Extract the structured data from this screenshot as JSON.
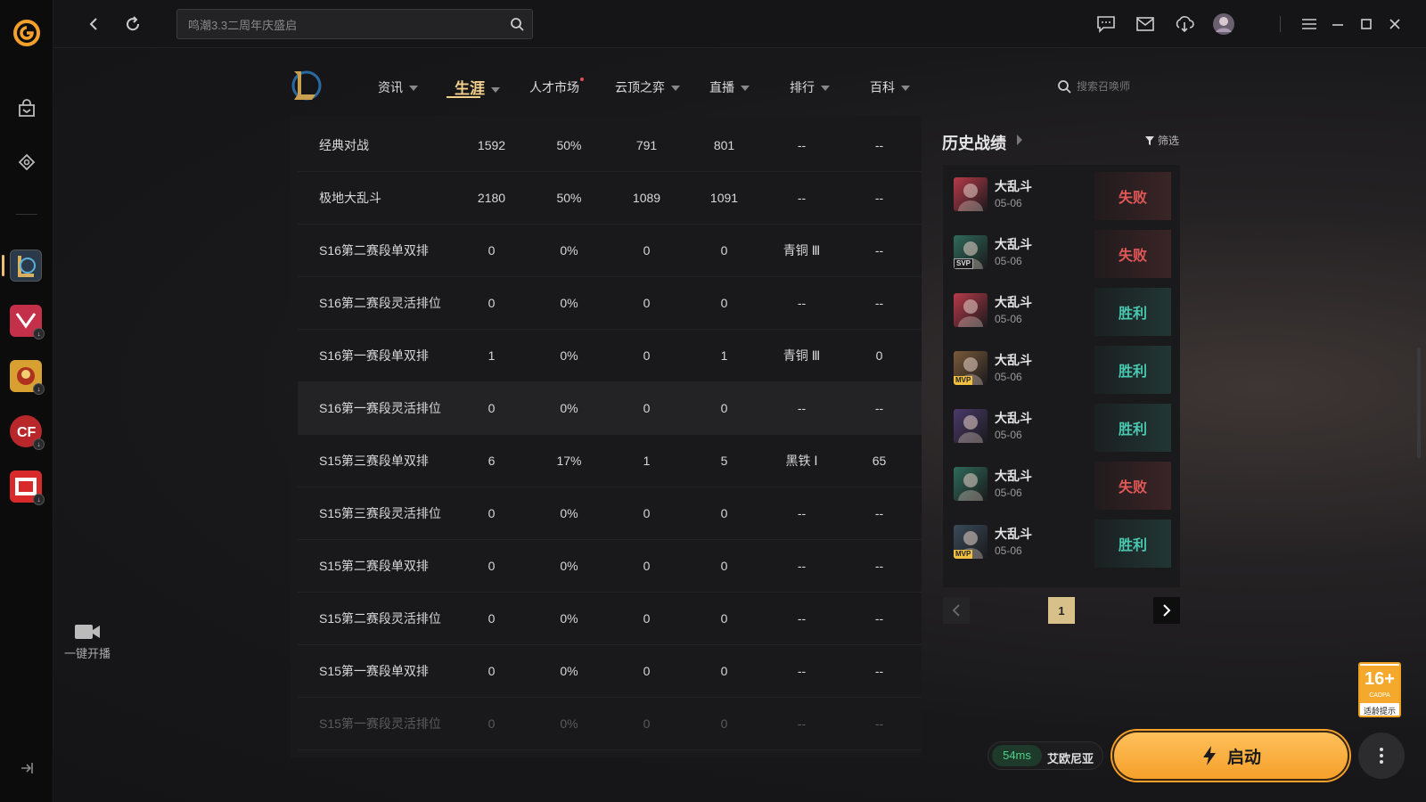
{
  "topbar": {
    "search_value": "鸣潮3.3二周年庆盛启"
  },
  "nav": {
    "items": [
      {
        "label": "资讯",
        "caret": true
      },
      {
        "label": "生涯",
        "caret": true,
        "active": true
      },
      {
        "label": "人才市场",
        "dot": true
      },
      {
        "label": "云顶之弈",
        "caret": true
      },
      {
        "label": "直播",
        "caret": true
      },
      {
        "label": "排行",
        "caret": true
      },
      {
        "label": "百科",
        "caret": true
      }
    ],
    "summoner_search_placeholder": "搜索召唤师"
  },
  "stats": {
    "rows": [
      {
        "mode": "经典对战",
        "games": "1592",
        "winrate": "50%",
        "wins": "791",
        "losses": "801",
        "rank": "--",
        "points": "--"
      },
      {
        "mode": "极地大乱斗",
        "games": "2180",
        "winrate": "50%",
        "wins": "1089",
        "losses": "1091",
        "rank": "--",
        "points": "--"
      },
      {
        "mode": "S16第二赛段单双排",
        "games": "0",
        "winrate": "0%",
        "wins": "0",
        "losses": "0",
        "rank": "青铜 Ⅲ",
        "points": "--"
      },
      {
        "mode": "S16第二赛段灵活排位",
        "games": "0",
        "winrate": "0%",
        "wins": "0",
        "losses": "0",
        "rank": "--",
        "points": "--"
      },
      {
        "mode": "S16第一赛段单双排",
        "games": "1",
        "winrate": "0%",
        "wins": "0",
        "losses": "1",
        "rank": "青铜 Ⅲ",
        "points": "0"
      },
      {
        "mode": "S16第一赛段灵活排位",
        "games": "0",
        "winrate": "0%",
        "wins": "0",
        "losses": "0",
        "rank": "--",
        "points": "--"
      },
      {
        "mode": "S15第三赛段单双排",
        "games": "6",
        "winrate": "17%",
        "wins": "1",
        "losses": "5",
        "rank": "黑铁 Ⅰ",
        "points": "65"
      },
      {
        "mode": "S15第三赛段灵活排位",
        "games": "0",
        "winrate": "0%",
        "wins": "0",
        "losses": "0",
        "rank": "--",
        "points": "--"
      },
      {
        "mode": "S15第二赛段单双排",
        "games": "0",
        "winrate": "0%",
        "wins": "0",
        "losses": "0",
        "rank": "--",
        "points": "--"
      },
      {
        "mode": "S15第二赛段灵活排位",
        "games": "0",
        "winrate": "0%",
        "wins": "0",
        "losses": "0",
        "rank": "--",
        "points": "--"
      },
      {
        "mode": "S15第一赛段单双排",
        "games": "0",
        "winrate": "0%",
        "wins": "0",
        "losses": "0",
        "rank": "--",
        "points": "--"
      },
      {
        "mode": "S15第一赛段灵活排位",
        "games": "0",
        "winrate": "0%",
        "wins": "0",
        "losses": "0",
        "rank": "--",
        "points": "--"
      }
    ]
  },
  "history": {
    "title": "历史战绩",
    "filter_label": "筛选",
    "matches": [
      {
        "mode": "大乱斗",
        "date": "05-06",
        "result": "失败",
        "outcome": "lose",
        "badge": "",
        "color": "#b83a4a"
      },
      {
        "mode": "大乱斗",
        "date": "05-06",
        "result": "失败",
        "outcome": "lose",
        "badge": "SVP",
        "color": "#2f6a5a"
      },
      {
        "mode": "大乱斗",
        "date": "05-06",
        "result": "胜利",
        "outcome": "win",
        "badge": "",
        "color": "#b83a4a"
      },
      {
        "mode": "大乱斗",
        "date": "05-06",
        "result": "胜利",
        "outcome": "win",
        "badge": "MVP",
        "color": "#7a5a3a"
      },
      {
        "mode": "大乱斗",
        "date": "05-06",
        "result": "胜利",
        "outcome": "win",
        "badge": "",
        "color": "#4a3a6a"
      },
      {
        "mode": "大乱斗",
        "date": "05-06",
        "result": "失败",
        "outcome": "lose",
        "badge": "",
        "color": "#2f6a5a"
      },
      {
        "mode": "大乱斗",
        "date": "05-06",
        "result": "胜利",
        "outcome": "win",
        "badge": "MVP",
        "color": "#3a4a5a"
      }
    ],
    "page": "1"
  },
  "sidebar": {
    "live_label": "一键开播"
  },
  "footer": {
    "ping": "54ms",
    "server": "艾欧尼亚",
    "launch_label": "启动",
    "age_rating": "16+",
    "age_rating_org": "CADPA",
    "age_tip": "适龄提示"
  },
  "colors": {
    "accent_gold": "#f1d08c",
    "win": "#48c8b0",
    "lose": "#e05858",
    "launch": "#f5a02a"
  }
}
